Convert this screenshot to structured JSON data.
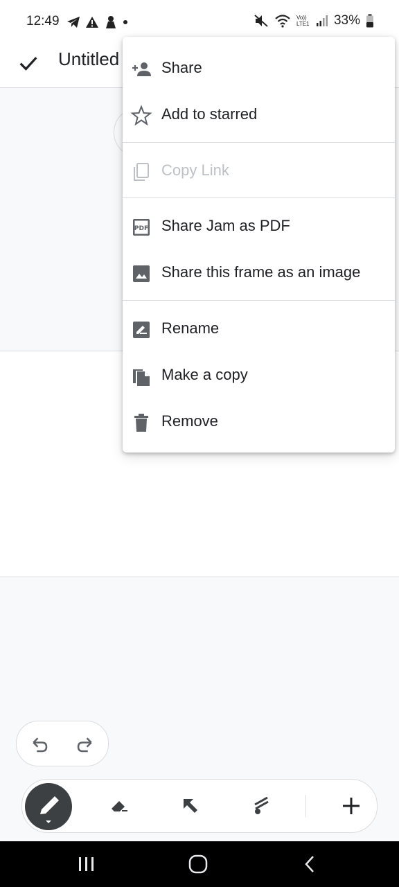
{
  "status_bar": {
    "time": "12:49",
    "battery_percent": "33%",
    "volte_label": "Vo)) LTE1"
  },
  "app_bar": {
    "title": "Untitled",
    "done_icon": "check-icon"
  },
  "menu": {
    "items": [
      {
        "label": "Share",
        "icon": "person-add-icon",
        "enabled": true
      },
      {
        "label": "Add to starred",
        "icon": "star-outline-icon",
        "enabled": true
      },
      {
        "label": "Copy Link",
        "icon": "copy-icon",
        "enabled": false
      },
      {
        "label": "Share Jam as PDF",
        "icon": "pdf-icon",
        "enabled": true
      },
      {
        "label": "Share this frame as an image",
        "icon": "image-icon",
        "enabled": true
      },
      {
        "label": "Rename",
        "icon": "rename-icon",
        "enabled": true
      },
      {
        "label": "Make a copy",
        "icon": "file-copy-icon",
        "enabled": true
      },
      {
        "label": "Remove",
        "icon": "trash-icon",
        "enabled": true
      }
    ]
  },
  "toolbar": {
    "tools": [
      "pen",
      "eraser",
      "select",
      "laser",
      "add"
    ],
    "active_tool": "pen"
  },
  "colors": {
    "accent_dark": "#3c4043",
    "disabled_text": "#bdc1c6",
    "icon_gray": "#5f6368"
  }
}
